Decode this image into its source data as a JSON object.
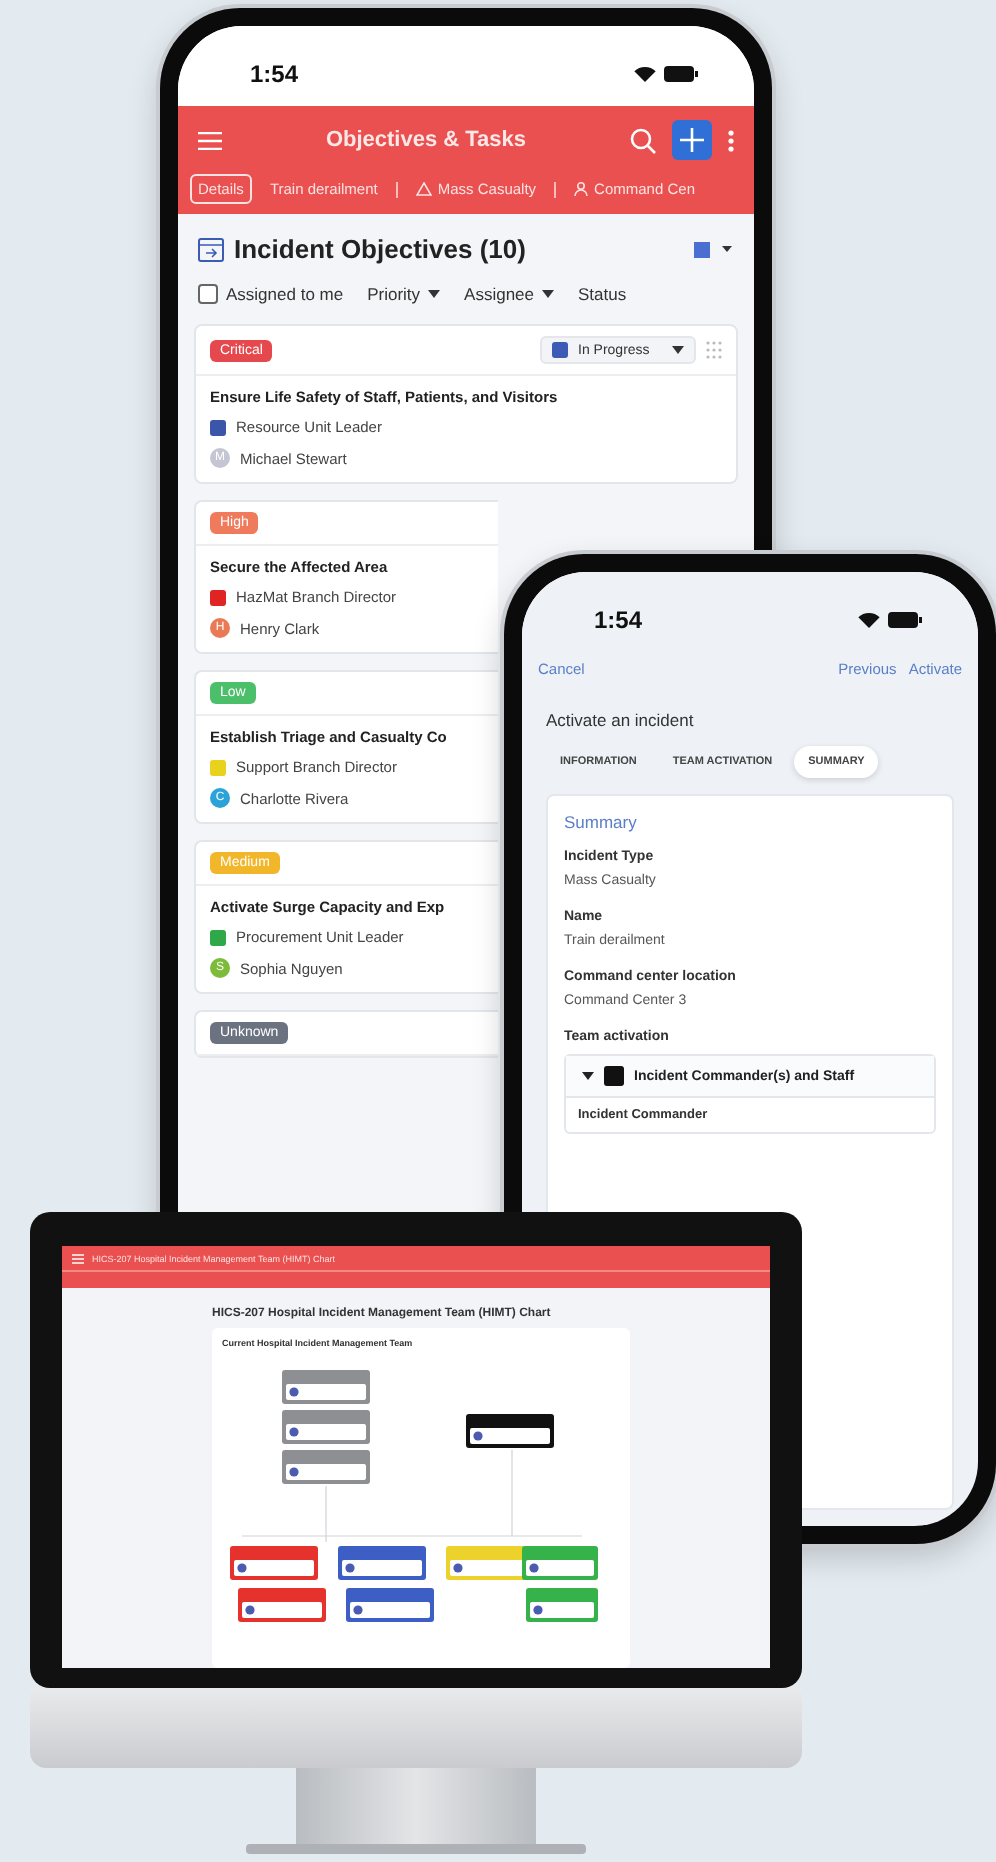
{
  "objectives_phone": {
    "status_bar": {
      "time": "1:54"
    },
    "header": {
      "title": "Objectives & Tasks"
    },
    "context_tabs": [
      {
        "label": "Details",
        "kind": "plain",
        "selected": true
      },
      {
        "label": "Train derailment",
        "kind": "plain",
        "selected": false
      },
      {
        "label": "Mass Casualty",
        "kind": "warning",
        "selected": false
      },
      {
        "label": "Command Cen",
        "kind": "person",
        "selected": false
      }
    ],
    "section": {
      "title": "Incident Objectives (10)"
    },
    "filters": [
      {
        "label": "Assigned to me",
        "kind": "checkbox",
        "checked": false
      },
      {
        "label": "Priority",
        "kind": "dropdown"
      },
      {
        "label": "Assignee",
        "kind": "dropdown"
      },
      {
        "label": "Status",
        "kind": "plain"
      }
    ],
    "objectives": [
      {
        "priority": "Critical",
        "color": "#e5484d",
        "status": {
          "label": "In Progress",
          "color": "#3b5bb5"
        },
        "title": "Ensure Life Safety of Staff, Patients, and Visitors",
        "role": {
          "name": "Resource Unit Leader",
          "color": "#3b56a8"
        },
        "assignee": {
          "initial": "M",
          "name": "Michael Stewart",
          "color": "#c5c6d3"
        }
      },
      {
        "priority": "High",
        "color": "#ef7a5c",
        "title": "Secure the Affected Area",
        "role": {
          "name": "HazMat Branch Director",
          "color": "#e02424"
        },
        "assignee": {
          "initial": "H",
          "name": "Henry Clark",
          "color": "#ea7a55"
        }
      },
      {
        "priority": "Low",
        "color": "#4cbf6b",
        "title": "Establish Triage and Casualty Co",
        "role": {
          "name": "Support Branch Director",
          "color": "#e8d21c"
        },
        "assignee": {
          "initial": "C",
          "name": "Charlotte Rivera",
          "color": "#2ba3d8"
        }
      },
      {
        "priority": "Medium",
        "color": "#f2b62b",
        "title": "Activate Surge Capacity and Exp",
        "role": {
          "name": "Procurement Unit Leader",
          "color": "#2fa84a"
        },
        "assignee": {
          "initial": "S",
          "name": "Sophia Nguyen",
          "color": "#7cbc3a"
        }
      },
      {
        "priority": "Unknown",
        "color": "#6b7280"
      }
    ]
  },
  "activation_phone": {
    "status_bar": {
      "time": "1:54"
    },
    "nav": {
      "cancel": "Cancel",
      "previous": "Previous",
      "activate": "Activate"
    },
    "title": "Activate an incident",
    "steps": [
      {
        "label": "INFORMATION",
        "selected": false
      },
      {
        "label": "TEAM ACTIVATION",
        "selected": false
      },
      {
        "label": "SUMMARY",
        "selected": true
      }
    ],
    "summary": {
      "heading": "Summary",
      "fields": [
        {
          "label": "Incident Type",
          "value": "Mass Casualty"
        },
        {
          "label": "Name",
          "value": "Train derailment"
        },
        {
          "label": "Command center location",
          "value": "Command Center 3"
        }
      ],
      "team_heading": "Team activation",
      "groups": [
        {
          "name": "Incident Commander(s) and Staff",
          "color": "#111111",
          "expanded": true,
          "roles": [
            "Incident Commander"
          ]
        }
      ]
    }
  },
  "monitor": {
    "header": {
      "title": "HICS-207 Hospital Incident Management Team (HIMT) Chart"
    },
    "page_title": "HICS-207 Hospital Incident Management Team (HIMT) Chart",
    "chart_card": {
      "title": "Current Hospital Incident Management Team"
    }
  }
}
